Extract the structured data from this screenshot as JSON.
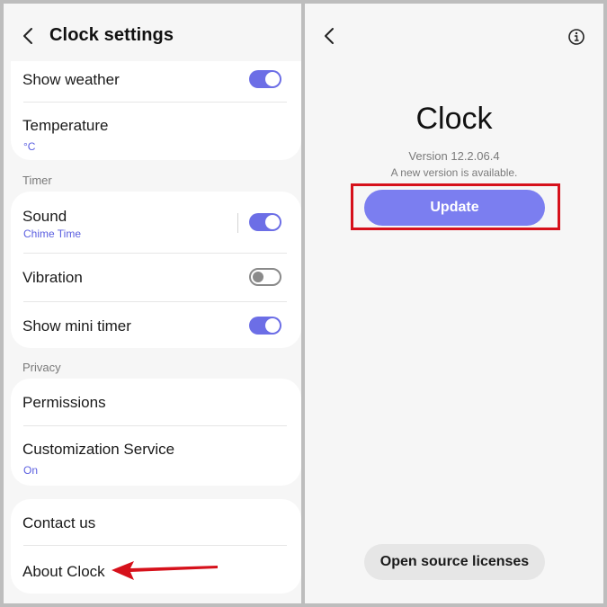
{
  "left": {
    "title": "Clock settings",
    "rows": {
      "show_weather": {
        "label": "Show weather",
        "toggle_on": true
      },
      "temperature": {
        "label": "Temperature",
        "sub": "°C"
      },
      "sound": {
        "label": "Sound",
        "sub": "Chime Time",
        "toggle_on": true
      },
      "vibration": {
        "label": "Vibration",
        "toggle_on": false
      },
      "show_mini_timer": {
        "label": "Show mini timer",
        "toggle_on": true
      },
      "permissions": {
        "label": "Permissions"
      },
      "customization_service": {
        "label": "Customization Service",
        "sub": "On"
      },
      "contact_us": {
        "label": "Contact us"
      },
      "about_clock": {
        "label": "About Clock"
      }
    },
    "sections": {
      "timer": "Timer",
      "privacy": "Privacy"
    }
  },
  "right": {
    "app_name": "Clock",
    "version": "Version 12.2.06.4",
    "update_note": "A new version is available.",
    "update_label": "Update",
    "oss_label": "Open source licenses"
  },
  "colors": {
    "accent": "#6c6ee6",
    "update_button": "#7b7ef0",
    "annotation_red": "#d6111b"
  },
  "icons": [
    "back-icon",
    "info-icon",
    "annotation-arrow"
  ]
}
